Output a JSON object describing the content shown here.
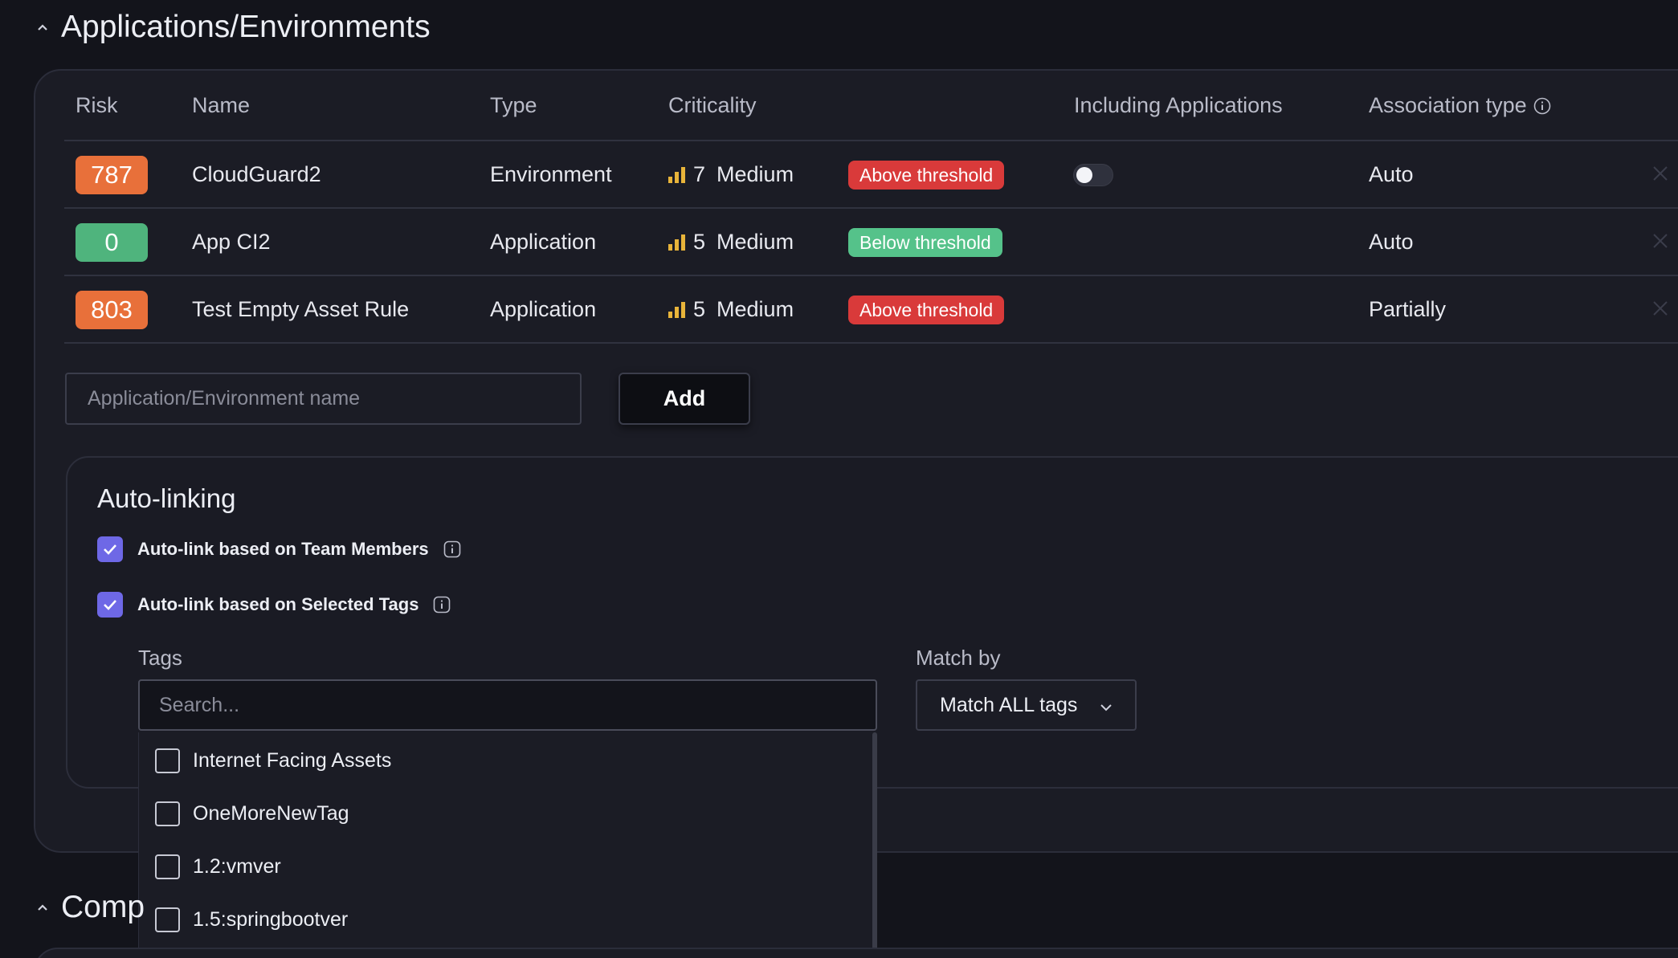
{
  "sections": {
    "applications_title": "Applications/Environments",
    "compliance_title": "Comp"
  },
  "table": {
    "headers": [
      "Risk",
      "Name",
      "Type",
      "Criticality",
      "Including Applications",
      "Association type"
    ],
    "rows": [
      {
        "risk": "787",
        "risk_color": "#e8703a",
        "name": "CloudGuard2",
        "type": "Environment",
        "criticality_num": "7",
        "criticality_label": "Medium",
        "threshold": "Above threshold",
        "threshold_color": "#d93a3a",
        "including_toggle": true,
        "association": "Auto"
      },
      {
        "risk": "0",
        "risk_color": "#4fb47d",
        "name": "App CI2",
        "type": "Application",
        "criticality_num": "5",
        "criticality_label": "Medium",
        "threshold": "Below threshold",
        "threshold_color": "#55c28a",
        "including_toggle": false,
        "association": "Auto"
      },
      {
        "risk": "803",
        "risk_color": "#e8703a",
        "name": "Test Empty Asset Rule",
        "type": "Application",
        "criticality_num": "5",
        "criticality_label": "Medium",
        "threshold": "Above threshold",
        "threshold_color": "#d93a3a",
        "including_toggle": false,
        "association": "Partially"
      }
    ]
  },
  "add_form": {
    "placeholder": "Application/Environment name",
    "button_label": "Add"
  },
  "autolink": {
    "title": "Auto-linking",
    "team_members_label": "Auto-link based on Team Members",
    "selected_tags_label": "Auto-link based on Selected Tags",
    "tags_label": "Tags",
    "search_placeholder": "Search...",
    "match_by_label": "Match by",
    "match_by_value": "Match ALL tags",
    "tag_options": [
      "Internet Facing Assets",
      "OneMoreNewTag",
      "1.2:vmver",
      "1.5:springbootver"
    ]
  },
  "colors": {
    "accent": "#6e68e6",
    "criticality_bars": "#e8b43a"
  }
}
